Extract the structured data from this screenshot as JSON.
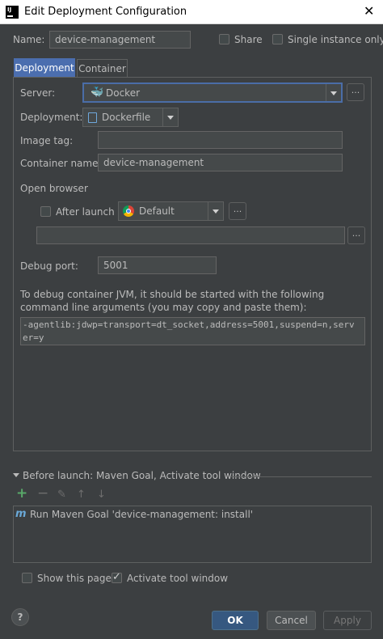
{
  "window": {
    "title": "Edit Deployment Configuration"
  },
  "header": {
    "name_label": "Name:",
    "name_value": "device-management",
    "share_label": "Share",
    "single_instance_label": "Single instance only"
  },
  "tabs": [
    {
      "label": "Deployment",
      "active": true
    },
    {
      "label": "Container",
      "active": false
    }
  ],
  "deployment": {
    "server_label": "Server:",
    "server_value": "Docker",
    "deployment_label": "Deployment:",
    "deployment_value": "Dockerfile",
    "image_tag_label": "Image tag:",
    "image_tag_value": "",
    "container_name_label": "Container name:",
    "container_name_value": "device-management",
    "open_browser_label": "Open browser",
    "after_launch_label": "After launch",
    "browser_value": "Default",
    "url_value": "",
    "debug_port_label": "Debug port:",
    "debug_port_value": "5001",
    "debug_info_line1": "To debug container JVM, it should be started with the following",
    "debug_info_line2": "command line arguments (you may copy and paste them):",
    "jvm_args_line1": "-agentlib:jdwp=transport=dt_socket,address=5001,suspend=n,serv",
    "jvm_args_line2": "er=y",
    "ellipsis": "..."
  },
  "before_launch": {
    "title": "Before launch: Maven Goal, Activate tool window",
    "toolbar_icons": [
      "add-icon",
      "remove-icon",
      "edit-icon",
      "move-up-icon",
      "move-down-icon"
    ],
    "items": [
      {
        "label": "Run Maven Goal 'device-management: install'"
      }
    ]
  },
  "options": {
    "show_this_page_label": "Show this page",
    "activate_tool_window_label": "Activate tool window"
  },
  "buttons": {
    "help": "?",
    "ok": "OK",
    "cancel": "Cancel",
    "apply": "Apply"
  },
  "colors": {
    "background": "#3c3f41",
    "accent": "#4b6eaf",
    "field": "#45494a",
    "add_green": "#59a869",
    "docker_blue": "#2496ed"
  }
}
